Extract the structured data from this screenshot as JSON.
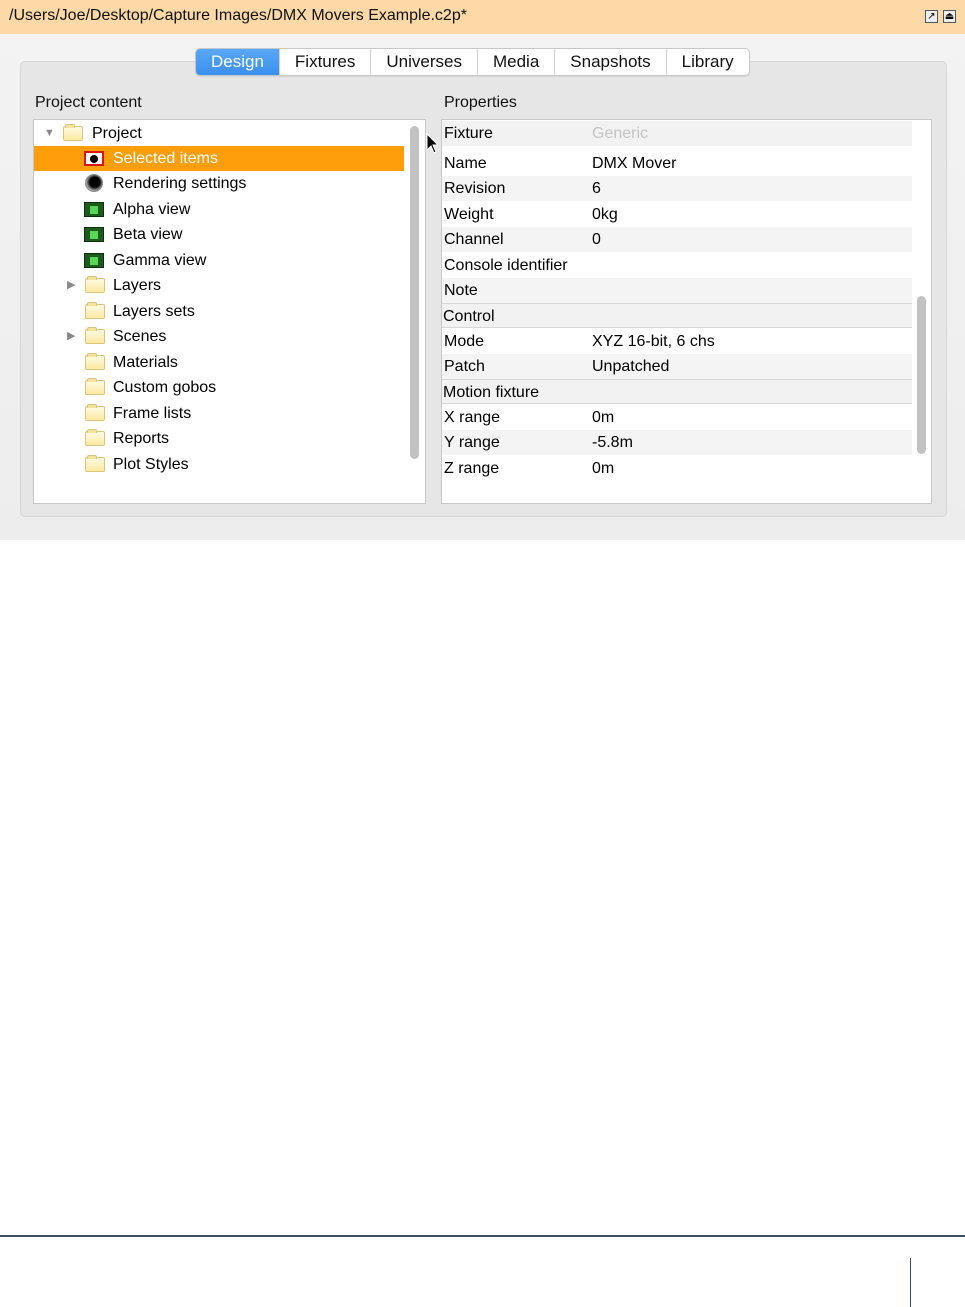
{
  "window": {
    "title": "/Users/Joe/Desktop/Capture Images/DMX Movers Example.c2p*",
    "title_buttons": [
      "pin-icon",
      "eject-icon"
    ],
    "title_bar_color": "#fdd9a8"
  },
  "tabs": [
    {
      "label": "Design",
      "active": true
    },
    {
      "label": "Fixtures",
      "active": false
    },
    {
      "label": "Universes",
      "active": false
    },
    {
      "label": "Media",
      "active": false
    },
    {
      "label": "Snapshots",
      "active": false
    },
    {
      "label": "Library",
      "active": false
    }
  ],
  "project": {
    "heading": "Project content",
    "tree": [
      {
        "label": "Project",
        "icon": "folder-icon",
        "expanded": true
      },
      {
        "label": "Selected items",
        "icon": "selection-icon",
        "selected": true
      },
      {
        "label": "Rendering settings",
        "icon": "render-icon"
      },
      {
        "label": "Alpha view",
        "icon": "view-icon"
      },
      {
        "label": "Beta view",
        "icon": "view-icon"
      },
      {
        "label": "Gamma view",
        "icon": "view-icon"
      },
      {
        "label": "Layers",
        "icon": "folder-icon",
        "expandable": true
      },
      {
        "label": "Layers sets",
        "icon": "folder-icon"
      },
      {
        "label": "Scenes",
        "icon": "folder-icon",
        "expandable": true
      },
      {
        "label": "Materials",
        "icon": "folder-icon"
      },
      {
        "label": "Custom gobos",
        "icon": "folder-icon"
      },
      {
        "label": "Frame lists",
        "icon": "folder-icon"
      },
      {
        "label": "Reports",
        "icon": "folder-icon"
      },
      {
        "label": "Plot Styles",
        "icon": "folder-icon"
      }
    ],
    "selection_color": "#ff9e0b"
  },
  "properties": {
    "heading": "Properties",
    "rows": [
      {
        "key": "Fixture",
        "value": "Generic",
        "type": "header"
      },
      {
        "key": "Name",
        "value": "DMX Mover"
      },
      {
        "key": "Revision",
        "value": "6"
      },
      {
        "key": "Weight",
        "value": "0kg"
      },
      {
        "key": "Channel",
        "value": "0"
      },
      {
        "key": "Console identifier",
        "value": ""
      },
      {
        "key": "Note",
        "value": ""
      },
      {
        "key": "Control",
        "value": "",
        "type": "group"
      },
      {
        "key": "Mode",
        "value": "XYZ 16-bit, 6 chs"
      },
      {
        "key": "Patch",
        "value": "Unpatched"
      },
      {
        "key": "Motion fixture",
        "value": "",
        "type": "group"
      },
      {
        "key": "X range",
        "value": "0m"
      },
      {
        "key": "Y range",
        "value": "-5.8m"
      },
      {
        "key": "Z range",
        "value": "0m"
      }
    ]
  }
}
